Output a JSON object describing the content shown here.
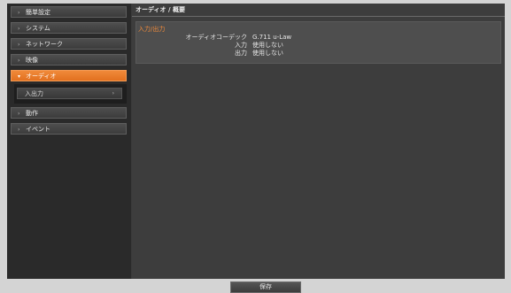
{
  "sidebar": {
    "items": [
      {
        "label": "簡単設定",
        "arrow": "›"
      },
      {
        "label": "システム",
        "arrow": "›"
      },
      {
        "label": "ネットワーク",
        "arrow": "›"
      },
      {
        "label": "映像",
        "arrow": "›"
      },
      {
        "label": "オーディオ",
        "arrow": "▾"
      },
      {
        "label": "動作",
        "arrow": "›"
      },
      {
        "label": "イベント",
        "arrow": "›"
      }
    ],
    "submenu": {
      "label": "入出力",
      "chevron": "›"
    }
  },
  "main": {
    "title": "オーディオ / 概要",
    "section": "入力/出力",
    "rows": [
      {
        "key": "オーディオコーデック",
        "value": "G.711 u-Law"
      },
      {
        "key": "入力",
        "value": "使用しない"
      },
      {
        "key": "出力",
        "value": "使用しない"
      }
    ]
  },
  "footer": {
    "save_label": "保存"
  },
  "colors": {
    "accent": "#e97a2a",
    "panel": "#3d3d3d",
    "background": "#d4d4d4"
  }
}
